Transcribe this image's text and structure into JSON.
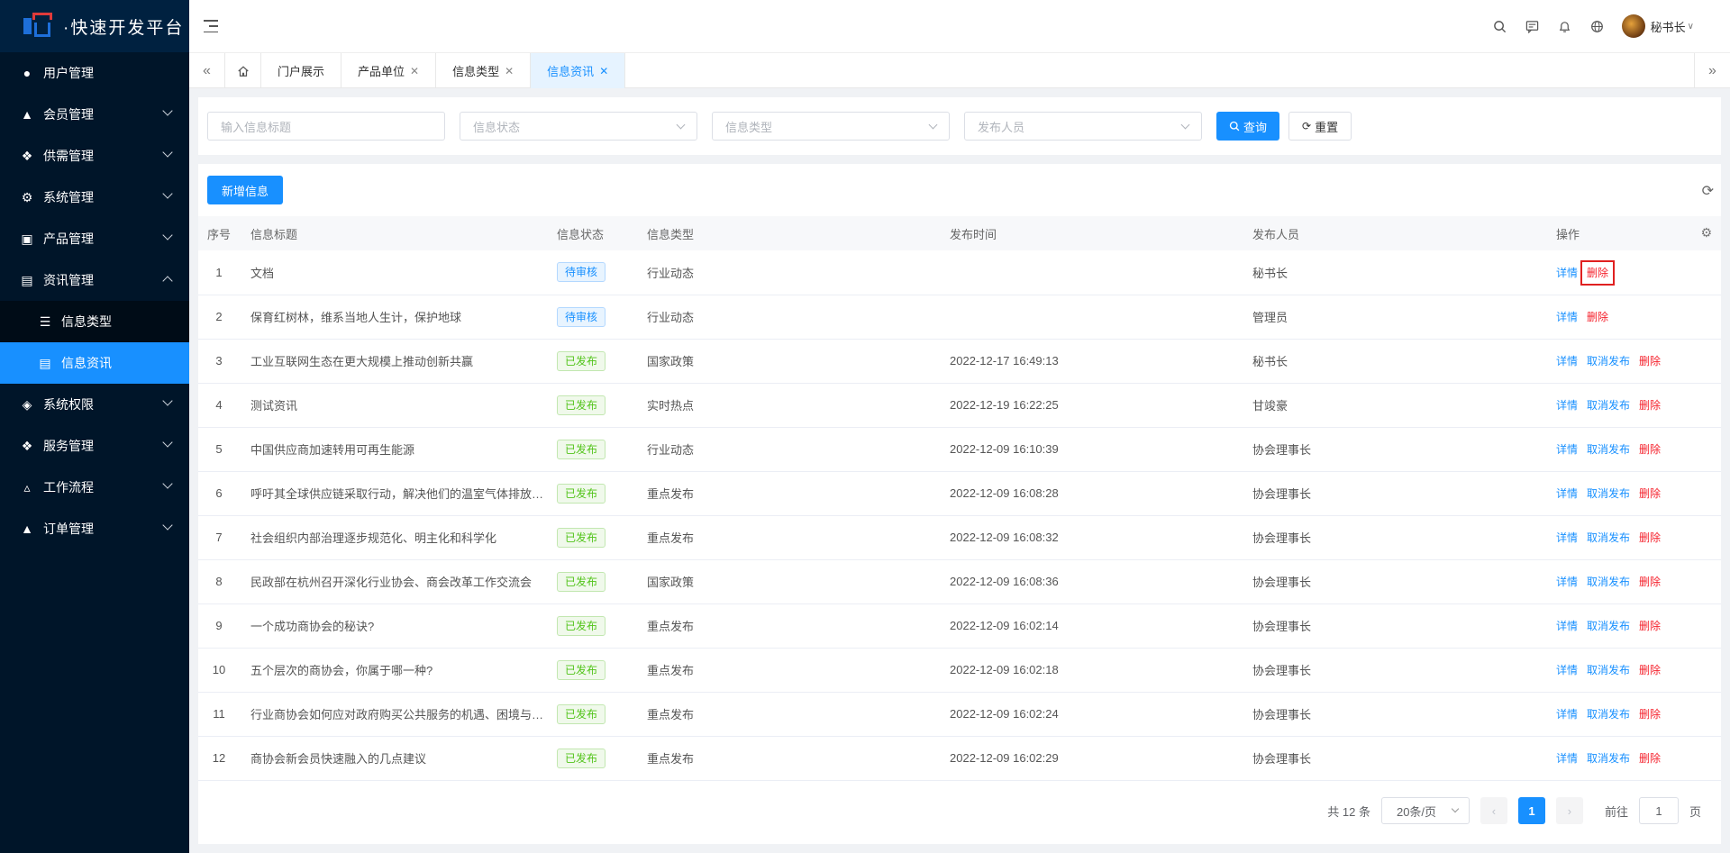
{
  "app": {
    "title": "·快速开发平台"
  },
  "sidebar": {
    "items": [
      {
        "label": "用户管理",
        "icon": "user-icon",
        "expandable": false
      },
      {
        "label": "会员管理",
        "icon": "members-icon",
        "expandable": true
      },
      {
        "label": "供需管理",
        "icon": "supply-icon",
        "expandable": true
      },
      {
        "label": "系统管理",
        "icon": "gear-icon",
        "expandable": true
      },
      {
        "label": "产品管理",
        "icon": "product-icon",
        "expandable": true
      },
      {
        "label": "资讯管理",
        "icon": "document-icon",
        "expandable": true,
        "expanded": true,
        "children": [
          {
            "label": "信息类型",
            "icon": "list-icon"
          },
          {
            "label": "信息资讯",
            "icon": "doc-icon",
            "active": true
          }
        ]
      },
      {
        "label": "系统权限",
        "icon": "shield-icon",
        "expandable": true
      },
      {
        "label": "服务管理",
        "icon": "service-icon",
        "expandable": true
      },
      {
        "label": "工作流程",
        "icon": "workflow-icon",
        "expandable": true
      },
      {
        "label": "订单管理",
        "icon": "order-icon",
        "expandable": true
      }
    ]
  },
  "header": {
    "username": "秘书长"
  },
  "tabs": [
    {
      "label": "门户展示",
      "closable": false
    },
    {
      "label": "产品单位",
      "closable": true
    },
    {
      "label": "信息类型",
      "closable": true
    },
    {
      "label": "信息资讯",
      "closable": true,
      "active": true
    }
  ],
  "search": {
    "title_placeholder": "输入信息标题",
    "status_placeholder": "信息状态",
    "type_placeholder": "信息类型",
    "publisher_placeholder": "发布人员",
    "query_label": "查询",
    "reset_label": "重置"
  },
  "toolbar": {
    "new_label": "新增信息"
  },
  "table": {
    "columns": [
      "序号",
      "信息标题",
      "信息状态",
      "信息类型",
      "发布时间",
      "发布人员",
      "操作"
    ],
    "action_labels": {
      "detail": "详情",
      "unpublish": "取消发布",
      "delete": "删除"
    },
    "rows": [
      {
        "no": "1",
        "title": "文档",
        "status": "待审核",
        "status_kind": "pending",
        "type": "行业动态",
        "time": "",
        "publisher": "秘书长"
      },
      {
        "no": "2",
        "title": "保育红树林，维系当地人生计，保护地球",
        "status": "待审核",
        "status_kind": "pending",
        "type": "行业动态",
        "time": "",
        "publisher": "管理员"
      },
      {
        "no": "3",
        "title": "工业互联网生态在更大规模上推动创新共赢",
        "status": "已发布",
        "status_kind": "published",
        "type": "国家政策",
        "time": "2022-12-17 16:49:13",
        "publisher": "秘书长"
      },
      {
        "no": "4",
        "title": "测试资讯",
        "status": "已发布",
        "status_kind": "published",
        "type": "实时热点",
        "time": "2022-12-19 16:22:25",
        "publisher": "甘竣豪"
      },
      {
        "no": "5",
        "title": "中国供应商加速转用可再生能源",
        "status": "已发布",
        "status_kind": "published",
        "type": "行业动态",
        "time": "2022-12-09 16:10:39",
        "publisher": "协会理事长"
      },
      {
        "no": "6",
        "title": "呼吁其全球供应链采取行动，解决他们的温室气体排放问...",
        "status": "已发布",
        "status_kind": "published",
        "type": "重点发布",
        "time": "2022-12-09 16:08:28",
        "publisher": "协会理事长"
      },
      {
        "no": "7",
        "title": "社会组织内部治理逐步规范化、明主化和科学化",
        "status": "已发布",
        "status_kind": "published",
        "type": "重点发布",
        "time": "2022-12-09 16:08:32",
        "publisher": "协会理事长"
      },
      {
        "no": "8",
        "title": "民政部在杭州召开深化行业协会、商会改革工作交流会",
        "status": "已发布",
        "status_kind": "published",
        "type": "国家政策",
        "time": "2022-12-09 16:08:36",
        "publisher": "协会理事长"
      },
      {
        "no": "9",
        "title": "一个成功商协会的秘诀?",
        "status": "已发布",
        "status_kind": "published",
        "type": "重点发布",
        "time": "2022-12-09 16:02:14",
        "publisher": "协会理事长"
      },
      {
        "no": "10",
        "title": "五个层次的商协会，你属于哪一种?",
        "status": "已发布",
        "status_kind": "published",
        "type": "重点发布",
        "time": "2022-12-09 16:02:18",
        "publisher": "协会理事长"
      },
      {
        "no": "11",
        "title": "行业商协会如何应对政府购买公共服务的机遇、困境与出路",
        "status": "已发布",
        "status_kind": "published",
        "type": "重点发布",
        "time": "2022-12-09 16:02:24",
        "publisher": "协会理事长"
      },
      {
        "no": "12",
        "title": "商协会新会员快速融入的几点建议",
        "status": "已发布",
        "status_kind": "published",
        "type": "重点发布",
        "time": "2022-12-09 16:02:29",
        "publisher": "协会理事长"
      }
    ]
  },
  "pagination": {
    "total_text": "共 12 条",
    "page_size": "20条/页",
    "current_page": "1",
    "goto_prefix": "前往",
    "goto_value": "1",
    "goto_suffix": "页"
  },
  "colors": {
    "primary": "#1890ff",
    "sidebar_bg": "#001529",
    "danger": "#f5222d",
    "success": "#52c41a"
  }
}
